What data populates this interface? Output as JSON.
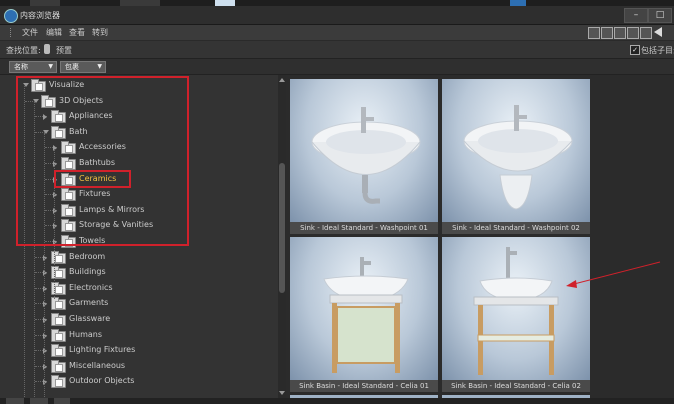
{
  "window": {
    "title": "内容浏览器"
  },
  "menu": {
    "items": [
      "文件",
      "编辑",
      "查看",
      "转到"
    ]
  },
  "location": {
    "label": "查找位置:",
    "value": "预置",
    "include_subdirs_label": "包括子目录"
  },
  "filters": {
    "name_dropdown": "名称",
    "type_dropdown": "包裹"
  },
  "tree": {
    "rows": [
      {
        "label": "Visualize",
        "depth": 0,
        "expanded": true
      },
      {
        "label": "3D Objects",
        "depth": 1,
        "expanded": true
      },
      {
        "label": "Appliances",
        "depth": 2,
        "expanded": false
      },
      {
        "label": "Bath",
        "depth": 2,
        "expanded": true
      },
      {
        "label": "Accessories",
        "depth": 3,
        "expanded": false
      },
      {
        "label": "Bathtubs",
        "depth": 3,
        "expanded": false
      },
      {
        "label": "Ceramics",
        "depth": 3,
        "expanded": false,
        "selected": true
      },
      {
        "label": "Fixtures",
        "depth": 3,
        "expanded": false
      },
      {
        "label": "Lamps & Mirrors",
        "depth": 3,
        "expanded": false
      },
      {
        "label": "Storage & Vanities",
        "depth": 3,
        "expanded": false
      },
      {
        "label": "Towels",
        "depth": 3,
        "expanded": false
      },
      {
        "label": "Bedroom",
        "depth": 2,
        "expanded": false
      },
      {
        "label": "Buildings",
        "depth": 2,
        "expanded": false
      },
      {
        "label": "Electronics",
        "depth": 2,
        "expanded": false
      },
      {
        "label": "Garments",
        "depth": 2,
        "expanded": false
      },
      {
        "label": "Glassware",
        "depth": 2,
        "expanded": false
      },
      {
        "label": "Humans",
        "depth": 2,
        "expanded": false
      },
      {
        "label": "Lighting Fixtures",
        "depth": 2,
        "expanded": false
      },
      {
        "label": "Miscellaneous",
        "depth": 2,
        "expanded": false
      },
      {
        "label": "Outdoor Objects",
        "depth": 2,
        "expanded": false
      }
    ]
  },
  "assets": [
    {
      "caption": "Sink - Ideal Standard - Washpoint 01",
      "kind": "wall-sink-siphon"
    },
    {
      "caption": "Sink - Ideal Standard - Washpoint 02",
      "kind": "wall-sink-pedestal"
    },
    {
      "caption": "Sink Basin - Ideal Standard - Celia 01",
      "kind": "basin-cabinet"
    },
    {
      "caption": "Sink Basin - Ideal Standard - Celia 02",
      "kind": "basin-shelf"
    }
  ],
  "colors": {
    "accent_selected": "#f5c242",
    "annotation_red": "#d0212b",
    "panel_bg": "#333333"
  }
}
